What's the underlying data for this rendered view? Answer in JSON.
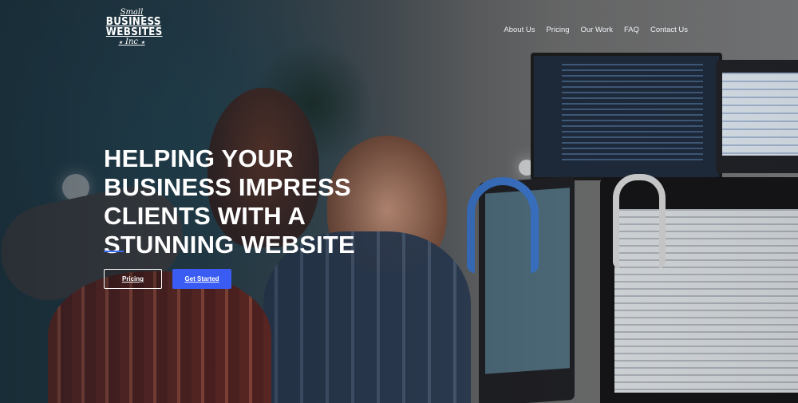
{
  "brand": {
    "small": "Small",
    "line1": "BUSINESS",
    "line2": "WEBSITES",
    "inc": "Inc"
  },
  "nav": {
    "items": [
      {
        "label": "About Us"
      },
      {
        "label": "Pricing"
      },
      {
        "label": "Our Work"
      },
      {
        "label": "FAQ"
      },
      {
        "label": "Contact Us"
      }
    ]
  },
  "hero": {
    "headline_lines": [
      "HELPING YOUR",
      "BUSINESS IMPRESS",
      "CLIENTS WITH A",
      "STUNNING WEBSITE"
    ],
    "accent_color": "#3c6ef5",
    "buttons": {
      "pricing_label": "Pricing",
      "get_started_label": "Get Started",
      "primary_color": "#3a5cf2"
    }
  }
}
